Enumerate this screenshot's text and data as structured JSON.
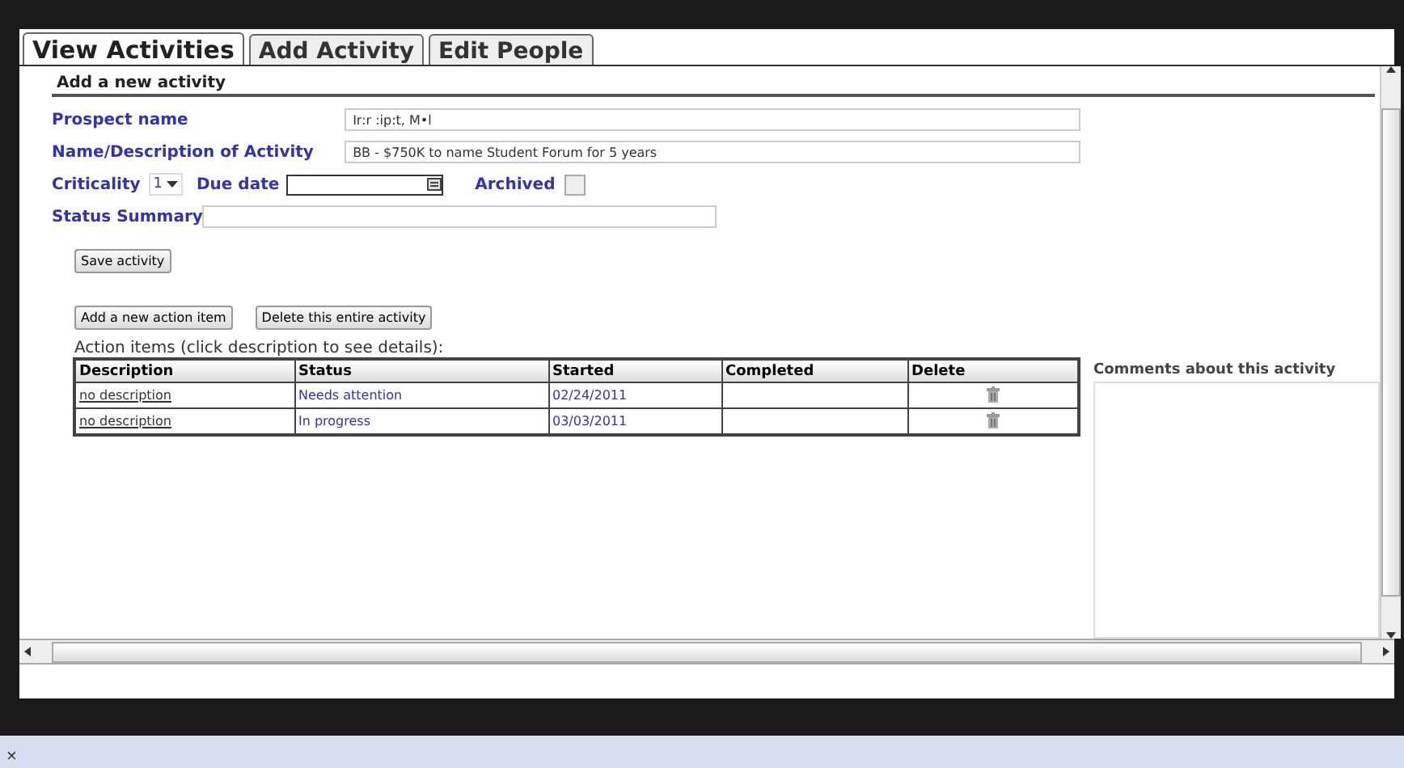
{
  "tabs": [
    {
      "label": "View Activities",
      "selected": true
    },
    {
      "label": "Add Activity",
      "selected": false
    },
    {
      "label": "Edit People",
      "selected": false
    }
  ],
  "section_title": "Add a new activity",
  "prospect_name": {
    "label": "Prospect name",
    "value": "Ir:r :ip:t, M•l"
  },
  "activity_name": {
    "label": "Name/Description of Activity",
    "value": "BB - $750K to name Student Forum for 5 years"
  },
  "criticality": {
    "label": "Criticality",
    "value": "1"
  },
  "due_date": {
    "label": "Due date"
  },
  "archived": {
    "label": "Archived",
    "checked": false
  },
  "status_summary": {
    "label": "Status Summary"
  },
  "save_button": "Save activity",
  "action_buttons": [
    "Add a new action item",
    "Delete this entire activity"
  ],
  "action_items": {
    "caption": "Action items (click description to see details):",
    "columns": [
      "Description",
      "Status",
      "Started",
      "Completed",
      "Delete"
    ],
    "rows": [
      {
        "description": "no description",
        "status": "Needs attention",
        "started": "02/24/2011"
      },
      {
        "description": "no description",
        "status": "In progress",
        "started": "03/03/2011"
      }
    ]
  },
  "comments": {
    "label": "Comments about this activity"
  },
  "notification_bar": {
    "close": "×"
  }
}
